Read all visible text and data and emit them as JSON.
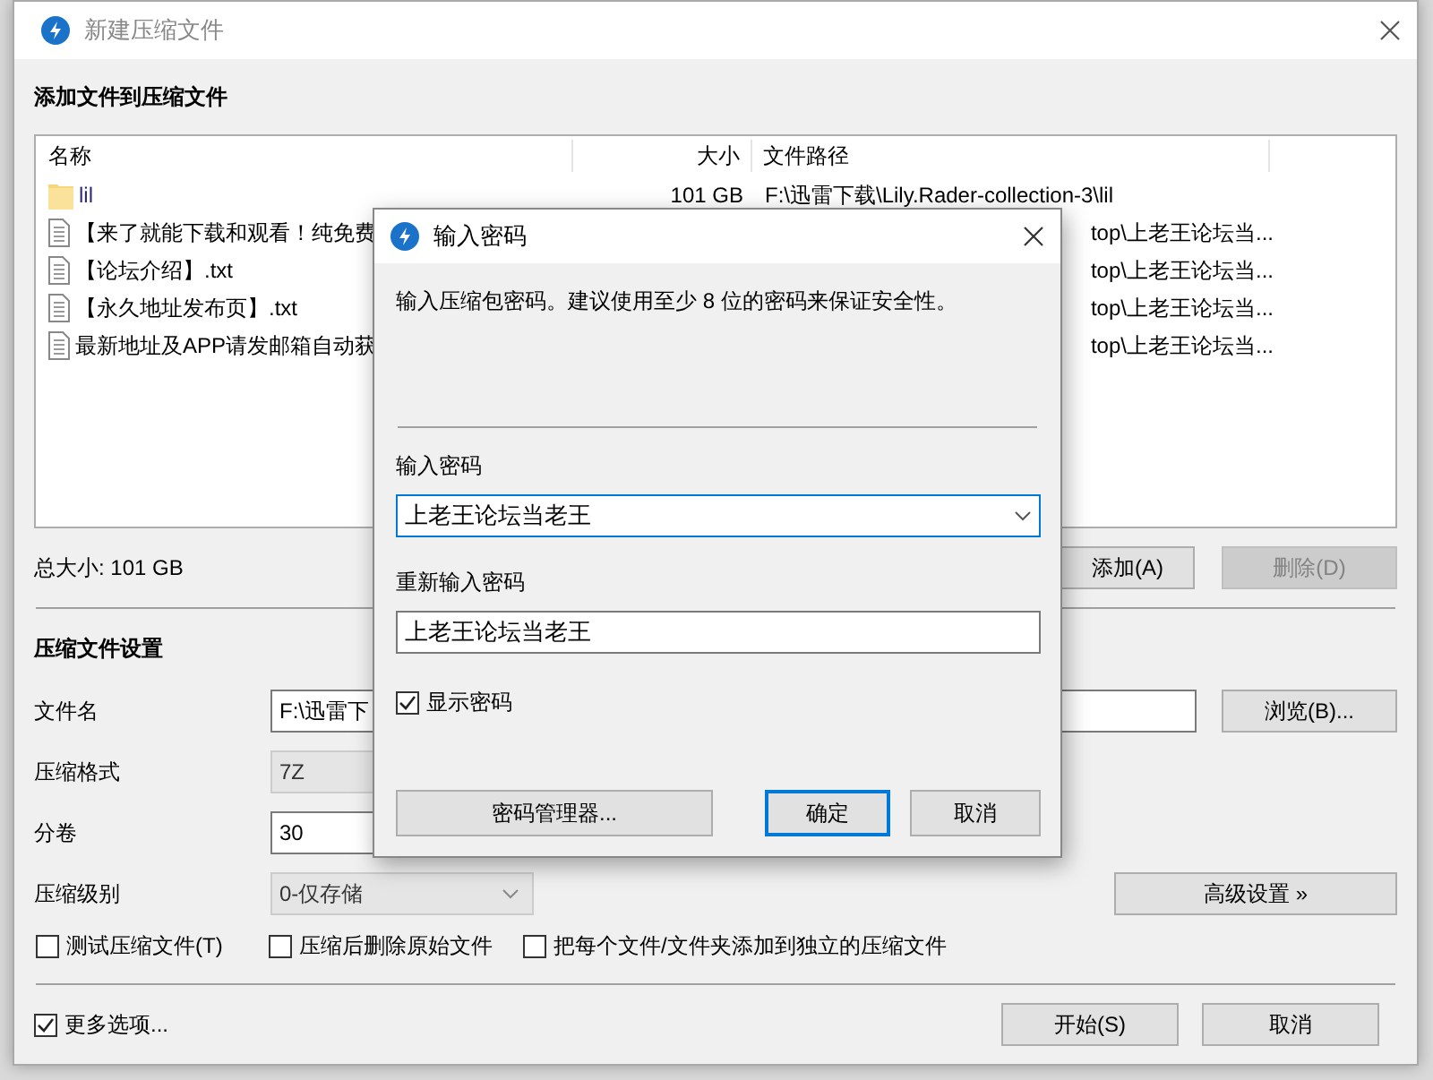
{
  "window": {
    "title": "新建压缩文件"
  },
  "add_heading": "添加文件到压缩文件",
  "file_list": {
    "columns": [
      "名称",
      "大小",
      "文件路径"
    ],
    "rows": [
      {
        "kind": "folder",
        "name": "lil",
        "size": "101 GB",
        "path": "F:\\迅雷下载\\Lily.Rader-collection-3\\lil"
      },
      {
        "kind": "file",
        "name": "【来了就能下载和观看！纯免费",
        "path": "top\\上老王论坛当..."
      },
      {
        "kind": "file",
        "name": "【论坛介绍】.txt",
        "path": "top\\上老王论坛当..."
      },
      {
        "kind": "file",
        "name": "【永久地址发布页】.txt",
        "path": "top\\上老王论坛当..."
      },
      {
        "kind": "file",
        "name": "最新地址及APP请发邮箱自动获",
        "path": "top\\上老王论坛当..."
      }
    ]
  },
  "total_size": "总大小: 101 GB",
  "list_buttons": [
    {
      "label": "添加(A)",
      "disabled": false
    },
    {
      "label": "删除(D)",
      "disabled": true
    }
  ],
  "settings": {
    "heading": "压缩文件设置",
    "fields": [
      {
        "kind": "text",
        "label": "文件名",
        "value": "F:\\迅雷下",
        "button": "浏览(B)..."
      },
      {
        "kind": "combo",
        "label": "压缩格式",
        "value": "7Z",
        "disabled": true
      },
      {
        "kind": "short",
        "label": "分卷",
        "value": "30"
      },
      {
        "kind": "select",
        "label": "压缩级别",
        "value": "0-仅存储",
        "disabled": true,
        "button": "高级设置 »"
      }
    ]
  },
  "options": [
    {
      "label": "测试压缩文件(T)",
      "checked": false
    },
    {
      "label": "压缩后删除原始文件",
      "checked": false
    },
    {
      "label": "把每个文件/文件夹添加到独立的压缩文件",
      "checked": false
    }
  ],
  "more_options": {
    "label": "更多选项...",
    "checked": true
  },
  "footer_buttons": [
    "开始(S)",
    "取消"
  ],
  "password_dialog": {
    "title": "输入密码",
    "hint": "输入压缩包密码。建议使用至少 8 位的密码来保证安全性。",
    "password_label": "输入密码",
    "password": "上老王论坛当老王",
    "confirm_label": "重新输入密码",
    "confirm": "上老王论坛当老王",
    "show_password": {
      "label": "显示密码",
      "checked": true
    },
    "buttons": [
      {
        "kind": "wide",
        "label": "密码管理器..."
      },
      {
        "kind": "default",
        "label": "确定"
      },
      {
        "kind": "normal",
        "label": "取消"
      }
    ]
  }
}
